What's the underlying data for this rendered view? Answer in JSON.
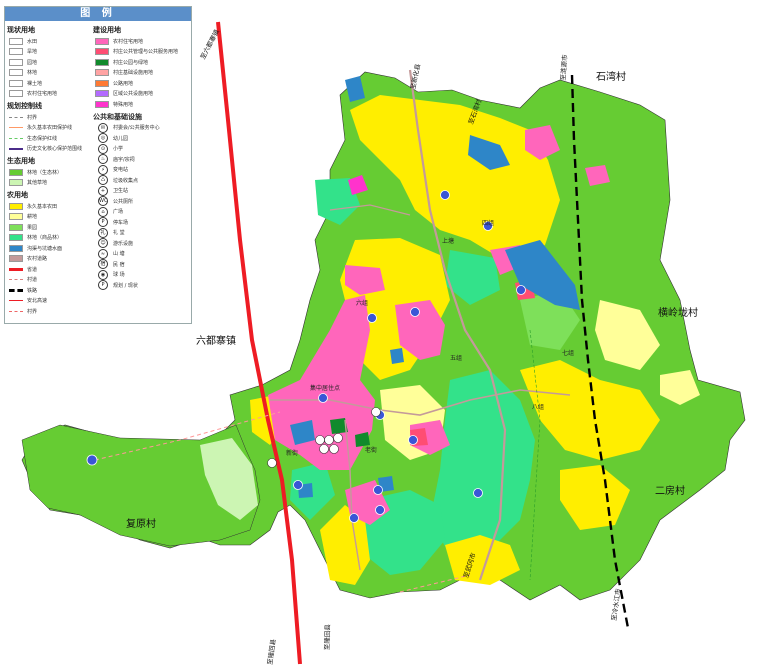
{
  "legend": {
    "title": "图 例",
    "current_land_use": {
      "title": "现状用地",
      "items": [
        {
          "label": "水田",
          "color": "#ffffff",
          "name": "paddy"
        },
        {
          "label": "旱地",
          "color": "#ffffff",
          "name": "dryland"
        },
        {
          "label": "园地",
          "color": "#ffffff",
          "name": "orchard"
        },
        {
          "label": "林地",
          "color": "#ffffff",
          "name": "forest"
        },
        {
          "label": "裸土地",
          "color": "#ffffff",
          "name": "bare"
        },
        {
          "label": "农村住宅用地",
          "color": "#ffffff",
          "name": "rural-housing"
        }
      ]
    },
    "planning_control_lines": {
      "title": "规划控制线",
      "items": [
        {
          "label": "村界",
          "name": "village-boundary"
        },
        {
          "label": "永久基本农田保护线",
          "name": "farmland-line"
        },
        {
          "label": "生态保护红线",
          "name": "eco-redline"
        },
        {
          "label": "历史文化核心保护范围线",
          "name": "heritage-line"
        }
      ]
    },
    "ecological_land": {
      "title": "生态用地",
      "items": [
        {
          "label": "林地（生态林）",
          "color": "#66cc33"
        },
        {
          "label": "其他草地",
          "color": "#ccf5b3"
        }
      ]
    },
    "agricultural_land": {
      "title": "农用地",
      "items": [
        {
          "label": "永久基本农田",
          "color": "#ffee00"
        },
        {
          "label": "耕地",
          "color": "#ffff99"
        },
        {
          "label": "果园",
          "color": "#7ee05a"
        },
        {
          "label": "林地（商品林）",
          "color": "#33e28a"
        },
        {
          "label": "沟渠与坑塘水面",
          "color": "#2e86c8"
        },
        {
          "label": "农村道路",
          "color": "#c49a9a"
        }
      ]
    },
    "roads": {
      "items": [
        {
          "label": "省道"
        },
        {
          "label": "村道"
        },
        {
          "label": "铁路"
        },
        {
          "label": "安北高速"
        },
        {
          "label": "村界"
        }
      ]
    },
    "construction_land": {
      "title": "建设用地",
      "items": [
        {
          "label": "农村住宅用地",
          "color": "#ff66bb"
        },
        {
          "label": "村庄公共管理与公共服务用地",
          "color": "#ff4d73"
        },
        {
          "label": "村庄公园与绿地",
          "color": "#118a2c"
        },
        {
          "label": "村庄基础设施用地",
          "color": "#ffa3a3"
        },
        {
          "label": "公路用地",
          "color": "#ff7a33"
        },
        {
          "label": "区域公共设施用地",
          "color": "#b36bff"
        },
        {
          "label": "特殊用地",
          "color": "#ff33cc"
        }
      ]
    },
    "facilities": {
      "title": "公共和基础设施",
      "items": [
        {
          "label": "村委会/公共服务中心",
          "glyph": "✉"
        },
        {
          "label": "幼儿园",
          "glyph": "◎"
        },
        {
          "label": "小学",
          "glyph": "⊙"
        },
        {
          "label": "庙宇/宗祠",
          "glyph": "♨"
        },
        {
          "label": "变电站",
          "glyph": "⚡"
        },
        {
          "label": "垃圾收集点",
          "glyph": "♺"
        },
        {
          "label": "卫生站",
          "glyph": "+"
        },
        {
          "label": "公共厕所",
          "glyph": "WC"
        },
        {
          "label": "广场",
          "glyph": "⌂"
        },
        {
          "label": "停车场",
          "glyph": "P"
        },
        {
          "label": "礼 堂",
          "glyph": "礼"
        },
        {
          "label": "游乐设施",
          "glyph": "☺"
        },
        {
          "label": "山 塘",
          "glyph": "≈"
        },
        {
          "label": "民 宿",
          "glyph": "宿"
        },
        {
          "label": "球 场",
          "glyph": "◉"
        },
        {
          "label": "规划 / 现状",
          "glyph": "P"
        }
      ]
    }
  },
  "map": {
    "villages": {
      "shiwan": "石湾村",
      "hengling": "横岭垅村",
      "liudu": "六都寨镇",
      "erfang": "二房村",
      "fuyuan": "复原村"
    },
    "roads": {
      "to_liudu": "至六都寨镇",
      "to_xinhua": "至新化县",
      "to_shishi": "至石湾村",
      "to_lianyuan": "至涟源市",
      "to_wugang": "至武冈市",
      "to_longhui_a": "至隆回县",
      "to_longhui_b": "至隆回县",
      "to_lengshuijiang": "至冷水江市"
    },
    "place_labels": {
      "xinjie": "新街",
      "jizhong": "集中居住点",
      "laojie": "老街",
      "shangtan": "上塘",
      "wujie": "五组",
      "liuzu": "六组",
      "qizu": "七组",
      "bazu": "八组",
      "sizu": "四组"
    },
    "colors": {
      "forest": "#66cc33",
      "farmland": "#ffee00",
      "cropland": "#ffff99",
      "commercial_forest": "#33e28a",
      "water": "#2e86c8",
      "housing": "#ff66bb",
      "public": "#ff4d73",
      "province_road": "#ee1c24",
      "village_road": "#c49a9a"
    }
  }
}
